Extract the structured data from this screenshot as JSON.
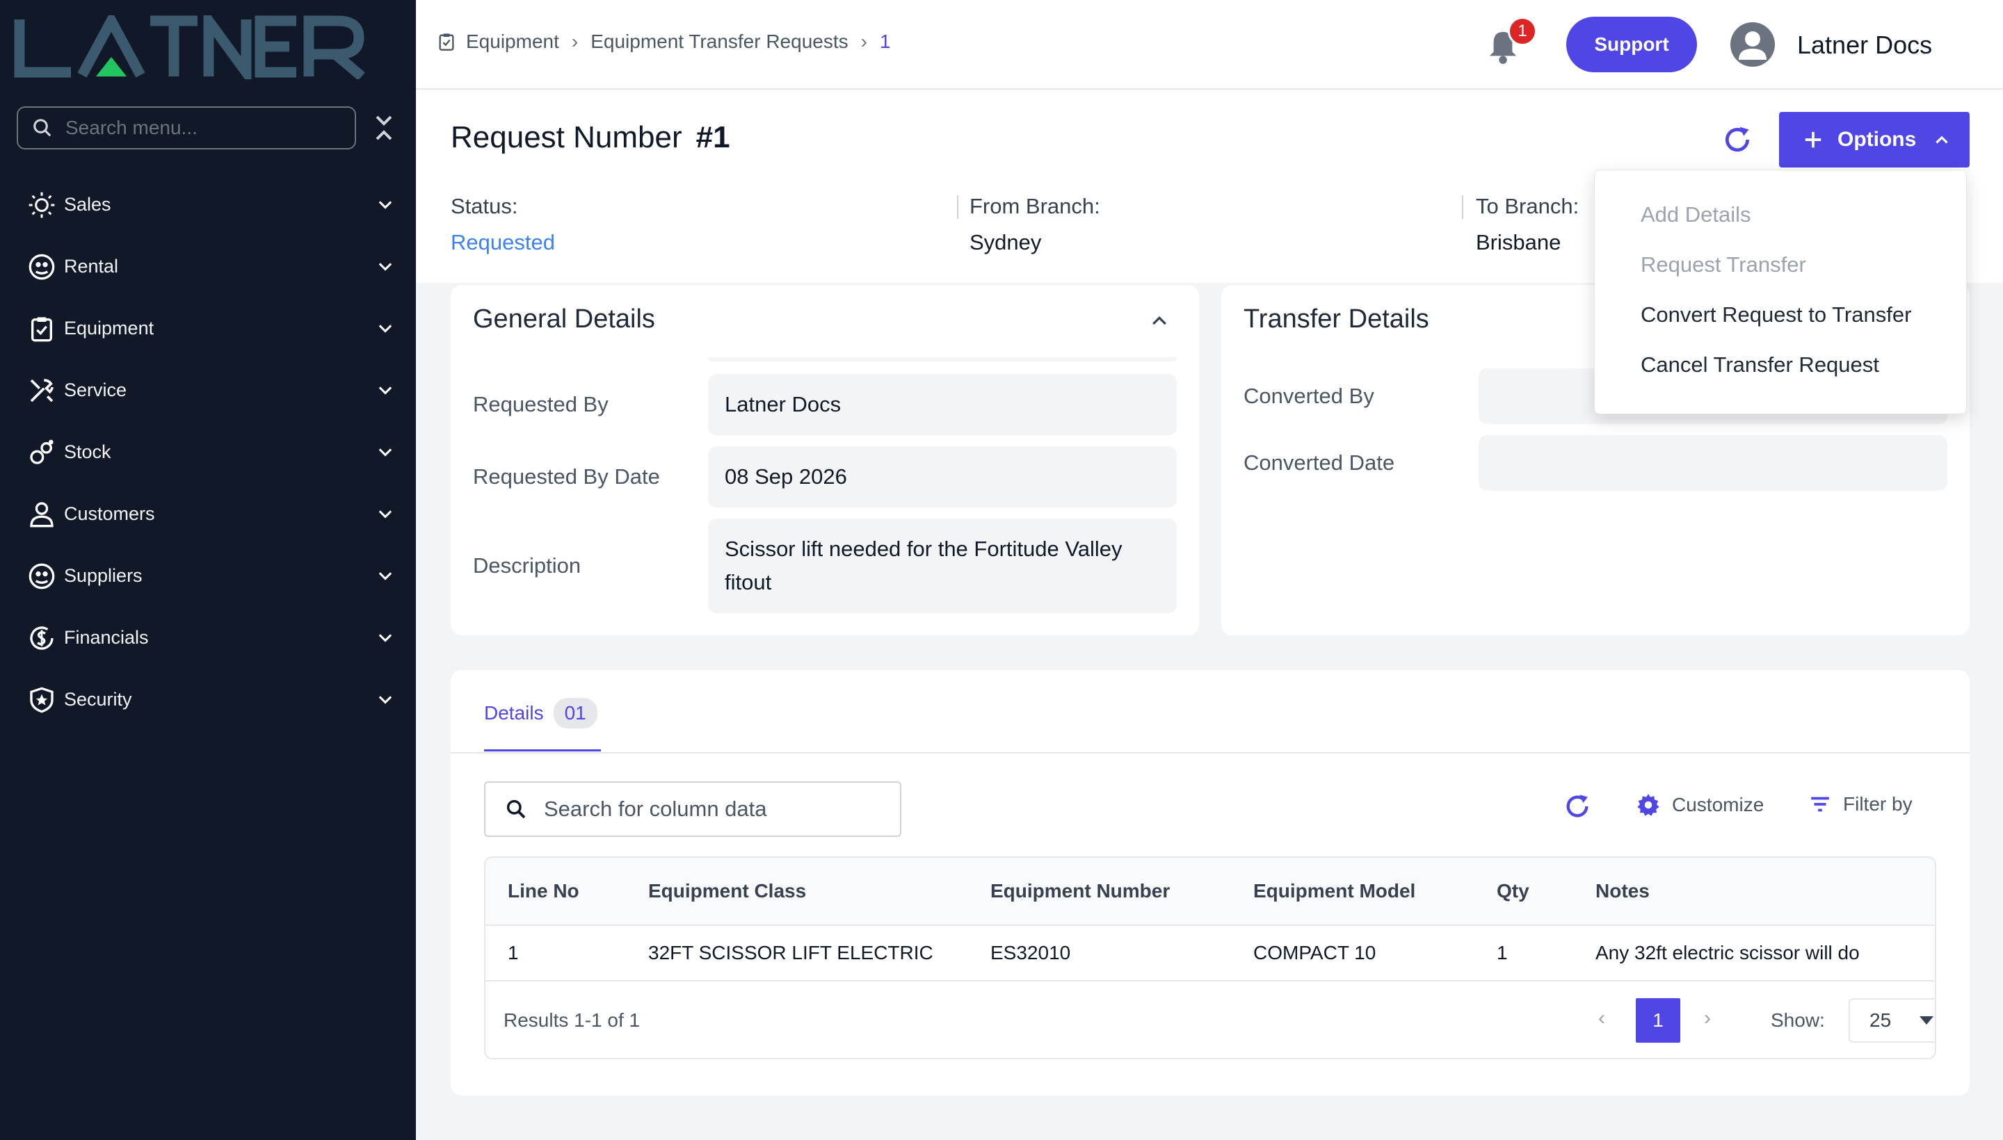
{
  "brand": {
    "logo_text": "LATNER"
  },
  "sidebar": {
    "search_placeholder": "Search menu...",
    "items": [
      {
        "label": "Sales",
        "icon": "sales-icon"
      },
      {
        "label": "Rental",
        "icon": "rental-icon"
      },
      {
        "label": "Equipment",
        "icon": "equipment-icon"
      },
      {
        "label": "Service",
        "icon": "service-icon"
      },
      {
        "label": "Stock",
        "icon": "stock-icon"
      },
      {
        "label": "Customers",
        "icon": "customers-icon"
      },
      {
        "label": "Suppliers",
        "icon": "suppliers-icon"
      },
      {
        "label": "Financials",
        "icon": "financials-icon"
      },
      {
        "label": "Security",
        "icon": "security-icon"
      }
    ]
  },
  "topbar": {
    "breadcrumb": [
      "Equipment",
      "Equipment Transfer Requests",
      "1"
    ],
    "notification_count": "1",
    "support_label": "Support",
    "user_name": "Latner Docs"
  },
  "header": {
    "title_prefix": "Request Number",
    "title_number": "#1",
    "options_label": "Options",
    "status_label": "Status:",
    "status_value": "Requested",
    "from_label": "From Branch:",
    "from_value": "Sydney",
    "to_label": "To Branch:",
    "to_value": "Brisbane"
  },
  "options_menu": {
    "items": [
      {
        "label": "Add Details",
        "disabled": true
      },
      {
        "label": "Request Transfer",
        "disabled": true
      },
      {
        "label": "Convert Request to Transfer",
        "disabled": false
      },
      {
        "label": "Cancel Transfer Request",
        "disabled": false
      }
    ]
  },
  "general_details": {
    "title": "General Details",
    "requested_by_label": "Requested By",
    "requested_by_value": "Latner Docs",
    "requested_date_label": "Requested By Date",
    "requested_date_value": "08 Sep 2026",
    "description_label": "Description",
    "description_value": "Scissor lift needed for the Fortitude Valley fitout"
  },
  "transfer_details": {
    "title": "Transfer Details",
    "converted_by_label": "Converted By",
    "converted_by_value": "",
    "converted_date_label": "Converted Date",
    "converted_date_value": ""
  },
  "details_section": {
    "tab_label": "Details",
    "tab_count": "01",
    "search_placeholder": "Search for column data",
    "customize_label": "Customize",
    "filter_label": "Filter by",
    "columns": [
      "Line No",
      "Equipment Class",
      "Equipment Number",
      "Equipment Model",
      "Qty",
      "Notes"
    ],
    "rows": [
      [
        "1",
        "32FT SCISSOR LIFT ELECTRIC",
        "ES32010",
        "COMPACT 10",
        "1",
        "Any 32ft electric scissor will do"
      ]
    ],
    "results_text": "Results 1-1 of 1",
    "current_page": "1",
    "show_label": "Show:",
    "page_size": "25"
  },
  "colors": {
    "accent": "#4f46e5",
    "sidebar_bg": "#111827",
    "status": "#3b82f6",
    "badge": "#dc2626"
  }
}
